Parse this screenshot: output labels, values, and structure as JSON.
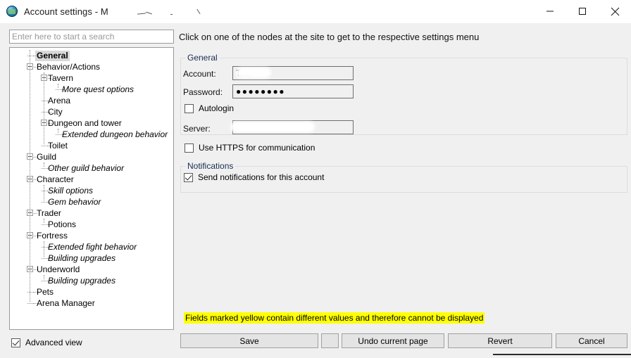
{
  "window": {
    "title": "Account settings - M",
    "app_icon": "globe-icon",
    "controls": {
      "minimize": "minimize-icon",
      "maximize": "maximize-icon",
      "close": "close-icon"
    }
  },
  "search": {
    "placeholder": "Enter here to start a search",
    "value": ""
  },
  "instruction": "Click on one of the nodes at the site to get to the respective settings menu",
  "tree": {
    "items": [
      {
        "label": "General",
        "depth": 1,
        "expander": false,
        "italic": false,
        "selected": true
      },
      {
        "label": "Behavior/Actions",
        "depth": 1,
        "expander": true,
        "italic": false,
        "selected": false
      },
      {
        "label": "Tavern",
        "depth": 2,
        "expander": true,
        "italic": false,
        "selected": false
      },
      {
        "label": "More quest options",
        "depth": 3,
        "expander": false,
        "italic": true,
        "selected": false
      },
      {
        "label": "Arena",
        "depth": 2,
        "expander": false,
        "italic": false,
        "selected": false
      },
      {
        "label": "City",
        "depth": 2,
        "expander": false,
        "italic": false,
        "selected": false
      },
      {
        "label": "Dungeon and tower",
        "depth": 2,
        "expander": true,
        "italic": false,
        "selected": false
      },
      {
        "label": "Extended dungeon behavior",
        "depth": 3,
        "expander": false,
        "italic": true,
        "selected": false
      },
      {
        "label": "Toilet",
        "depth": 2,
        "expander": false,
        "italic": false,
        "selected": false
      },
      {
        "label": "Guild",
        "depth": 1,
        "expander": true,
        "italic": false,
        "selected": false
      },
      {
        "label": "Other guild behavior",
        "depth": 2,
        "expander": false,
        "italic": true,
        "selected": false
      },
      {
        "label": "Character",
        "depth": 1,
        "expander": true,
        "italic": false,
        "selected": false
      },
      {
        "label": "Skill options",
        "depth": 2,
        "expander": false,
        "italic": true,
        "selected": false
      },
      {
        "label": "Gem behavior",
        "depth": 2,
        "expander": false,
        "italic": true,
        "selected": false
      },
      {
        "label": "Trader",
        "depth": 1,
        "expander": true,
        "italic": false,
        "selected": false
      },
      {
        "label": "Potions",
        "depth": 2,
        "expander": false,
        "italic": false,
        "selected": false
      },
      {
        "label": "Fortress",
        "depth": 1,
        "expander": true,
        "italic": false,
        "selected": false
      },
      {
        "label": "Extended fight behavior",
        "depth": 2,
        "expander": false,
        "italic": true,
        "selected": false
      },
      {
        "label": "Building upgrades",
        "depth": 2,
        "expander": false,
        "italic": true,
        "selected": false
      },
      {
        "label": "Underworld",
        "depth": 1,
        "expander": true,
        "italic": false,
        "selected": false
      },
      {
        "label": "Building upgrades",
        "depth": 2,
        "expander": false,
        "italic": true,
        "selected": false
      },
      {
        "label": "Pets",
        "depth": 1,
        "expander": false,
        "italic": false,
        "selected": false
      },
      {
        "label": "Arena Manager",
        "depth": 1,
        "expander": false,
        "italic": false,
        "selected": false
      }
    ]
  },
  "advanced_view": {
    "label": "Advanced view",
    "checked": true
  },
  "general_group": {
    "title": "General",
    "account_label": "Account:",
    "account_value": "Test",
    "account_redacted": true,
    "password_label": "Password:",
    "password_value": "●●●●●●●●",
    "autologin_label": "Autologin",
    "autologin_checked": false,
    "server_label": "Server:",
    "server_value": "",
    "server_redacted": true,
    "https_label": "Use HTTPS for communication",
    "https_checked": false
  },
  "notifications_group": {
    "title": "Notifications",
    "send_label": "Send notifications for this account",
    "send_checked": true
  },
  "warning": {
    "text": "Fields marked yellow contain different values and therefore cannot be displayed",
    "background": "#ffff00"
  },
  "buttons": {
    "save": "Save",
    "blank": "",
    "undo": "Undo current page",
    "revert": "Revert",
    "cancel": "Cancel"
  }
}
